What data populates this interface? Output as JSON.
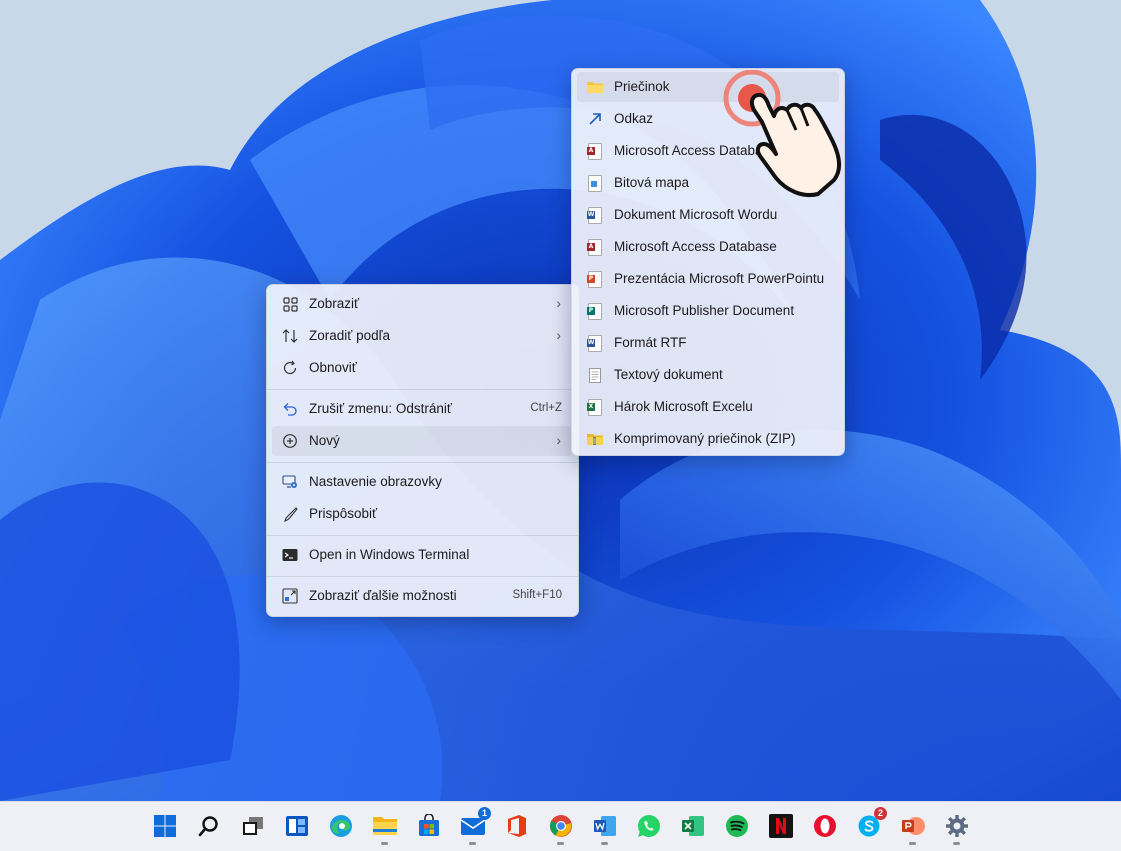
{
  "context_menu": {
    "items": [
      {
        "icon": "view-grid-icon",
        "label": "Zobraziť",
        "chevron": "›"
      },
      {
        "icon": "sort-icon",
        "label": "Zoradiť podľa",
        "chevron": "›"
      },
      {
        "icon": "refresh-icon",
        "label": "Obnoviť"
      },
      {
        "icon": "undo-icon",
        "label": "Zrušiť zmenu: Odstrániť",
        "shortcut": "Ctrl+Z"
      },
      {
        "icon": "new-plus-icon",
        "label": "Nový",
        "chevron": "›"
      },
      {
        "icon": "display-settings-icon",
        "label": "Nastavenie obrazovky"
      },
      {
        "icon": "personalize-brush-icon",
        "label": "Prispôsobiť"
      },
      {
        "icon": "terminal-icon",
        "label": "Open in Windows Terminal"
      },
      {
        "icon": "more-options-icon",
        "label": "Zobraziť ďalšie možnosti",
        "shortcut": "Shift+F10"
      }
    ]
  },
  "submenu_new": {
    "items": [
      {
        "icon": "folder-icon",
        "label": "Priečinok"
      },
      {
        "icon": "shortcut-arrow-icon",
        "label": "Odkaz"
      },
      {
        "icon": "access-file-icon",
        "label": "Microsoft Access Database"
      },
      {
        "icon": "bitmap-file-icon",
        "label": "Bitová mapa"
      },
      {
        "icon": "word-file-icon",
        "label": "Dokument Microsoft Wordu"
      },
      {
        "icon": "access-file-icon",
        "label": "Microsoft Access Database"
      },
      {
        "icon": "powerpoint-file-icon",
        "label": "Prezentácia Microsoft PowerPointu"
      },
      {
        "icon": "publisher-file-icon",
        "label": "Microsoft Publisher Document"
      },
      {
        "icon": "rtf-file-icon",
        "label": "Formát RTF"
      },
      {
        "icon": "text-file-icon",
        "label": "Textový dokument"
      },
      {
        "icon": "excel-file-icon",
        "label": "Hárok Microsoft Excelu"
      },
      {
        "icon": "zip-folder-icon",
        "label": "Komprimovaný priečinok (ZIP)"
      }
    ]
  },
  "taskbar": {
    "mail_badge": "1",
    "skype_badge": "2"
  },
  "colors": {
    "accent": "#0067c0",
    "wallpaper_blue": "#1e5ce6"
  }
}
